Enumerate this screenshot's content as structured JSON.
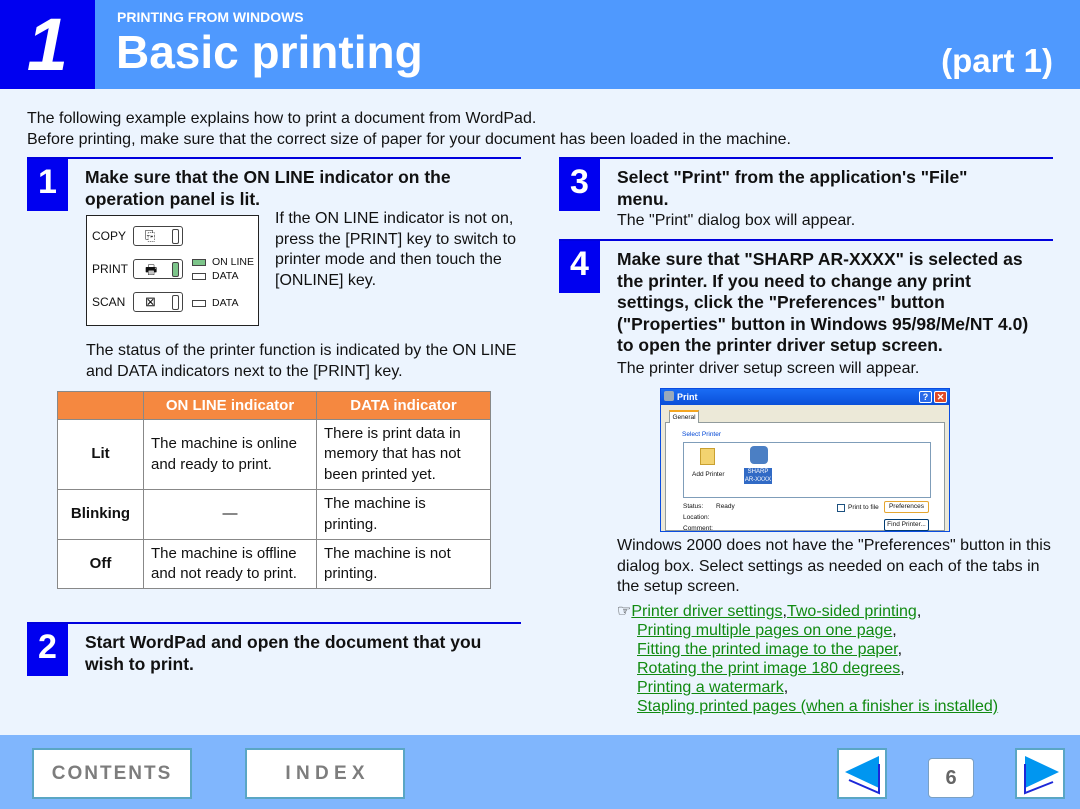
{
  "header": {
    "chapter_number": "1",
    "section": "PRINTING FROM WINDOWS",
    "title": "Basic printing",
    "part": "(part 1)"
  },
  "intro": [
    "The following example explains how to print a document from WordPad.",
    "Before printing, make sure that the correct size of paper for your document has been loaded in the machine."
  ],
  "steps": [
    {
      "number": "1",
      "title": "Make sure that the ON LINE indicator on the operation panel is lit.",
      "body": "If the ON LINE indicator is not on, press the [PRINT] key to switch to printer mode and then touch the [ONLINE] key.",
      "body2": "The status of the printer function is indicated by the ON LINE and DATA indicators next to the [PRINT] key."
    },
    {
      "number": "2",
      "title": "Start WordPad and open the document that you wish to print."
    },
    {
      "number": "3",
      "title": "Select \"Print\" from the application's \"File\" menu.",
      "body": "The \"Print\" dialog box will appear."
    },
    {
      "number": "4",
      "title": "Make sure that \"SHARP AR-XXXX\" is selected as the printer. If you need to change any print settings, click the \"Preferences\" button (\"Properties\" button in Windows 95/98/Me/NT 4.0) to open the printer driver setup screen.",
      "body": "The printer driver setup screen will appear.",
      "body2": "Windows 2000 does not have the \"Preferences\" button in this dialog box. Select settings as needed on each of the tabs in the setup screen."
    }
  ],
  "operation_panel": {
    "keys": [
      "COPY",
      "PRINT",
      "SCAN"
    ],
    "indicators": {
      "online": "ON LINE",
      "data": "DATA"
    }
  },
  "status_table": {
    "headers": [
      "",
      "ON LINE indicator",
      "DATA indicator"
    ],
    "rows": [
      [
        "Lit",
        "The machine is online and ready to print.",
        "There is print data in memory that has not been printed yet."
      ],
      [
        "Blinking",
        "—",
        "The machine is printing."
      ],
      [
        "Off",
        "The machine is offline and not ready to print.",
        "The machine is not printing."
      ]
    ]
  },
  "print_dialog": {
    "title": "Print",
    "tab": "General",
    "group": "Select Printer",
    "printers": [
      "Add Printer",
      "SHARP AR-XXXX"
    ],
    "status_label": "Status:",
    "status_value": "Ready",
    "location_label": "Location:",
    "comment_label": "Comment:",
    "print_to_file": "Print to file",
    "preferences_button": "Preferences",
    "find_printer_button": "Find Printer..."
  },
  "links": {
    "pointer": "☞",
    "items": [
      "Printer driver settings",
      "Two-sided printing",
      "Printing multiple pages on one page",
      "Fitting the printed image to the paper",
      "Rotating the print image 180 degrees",
      "Printing a watermark",
      "Stapling printed pages (when a finisher is installed)"
    ]
  },
  "footer": {
    "contents": "CONTENTS",
    "index": "I N D E X",
    "page": "6"
  },
  "colors": {
    "header_bg": "#4f99fe",
    "chapter_bg": "#0000f0",
    "table_header": "#f58840",
    "link": "#118a11",
    "footer_bg": "#80b6fd"
  }
}
